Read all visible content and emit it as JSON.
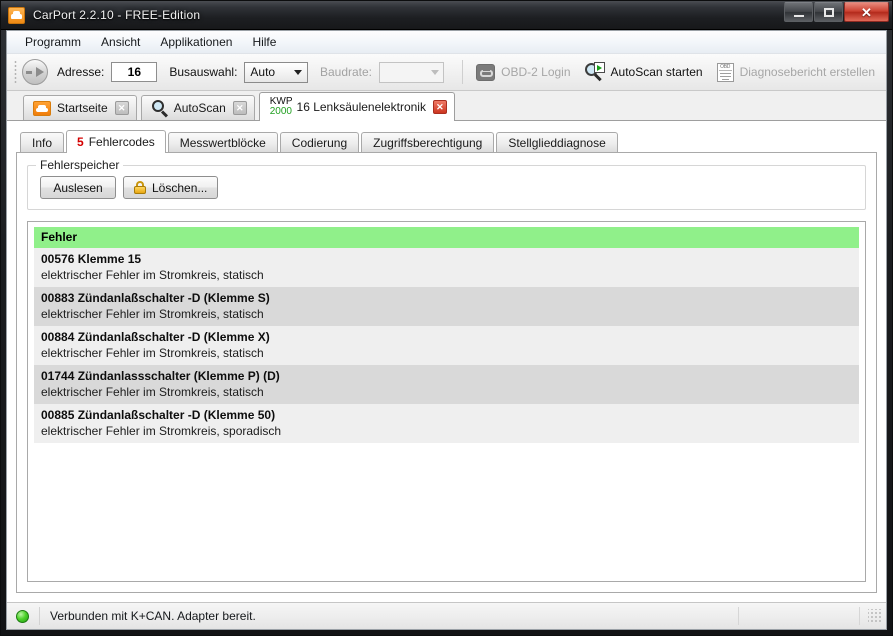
{
  "window": {
    "title": "CarPort 2.2.10  - FREE-Edition",
    "app_icon": "car-icon",
    "buttons": {
      "minimize": "–",
      "maximize": "□",
      "close": "✕"
    }
  },
  "menubar": {
    "items": [
      {
        "label": "Programm"
      },
      {
        "label": "Ansicht"
      },
      {
        "label": "Applikationen"
      },
      {
        "label": "Hilfe"
      }
    ]
  },
  "toolbar": {
    "nav_icon": "arrow-right-circle-icon",
    "address_label": "Adresse:",
    "address_value": "16",
    "bus_label": "Busauswahl:",
    "bus_value": "Auto",
    "baudrate_label": "Baudrate:",
    "baudrate_value": "",
    "actions": [
      {
        "label": "OBD-2 Login",
        "icon": "obd-plug-icon",
        "enabled": false
      },
      {
        "label": "AutoScan starten",
        "icon": "magnifier-play-icon",
        "enabled": true
      },
      {
        "label": "Diagnosebericht erstellen",
        "icon": "obd-document-icon",
        "enabled": false
      }
    ]
  },
  "outer_tabs": [
    {
      "label": "Startseite",
      "icon": "car-icon",
      "active": false,
      "close": "✕"
    },
    {
      "label": "AutoScan",
      "icon": "magnifier-icon",
      "active": false,
      "close": "✕"
    },
    {
      "label": "16 Lenksäulenelektronik",
      "protocol_line1": "KWP",
      "protocol_line2": "2000",
      "active": true,
      "close": "✕"
    }
  ],
  "inner_tabs": [
    {
      "label": "Info",
      "count": "",
      "active": false
    },
    {
      "label": "Fehlercodes",
      "count": "5",
      "active": true
    },
    {
      "label": "Messwertblöcke",
      "count": "",
      "active": false
    },
    {
      "label": "Codierung",
      "count": "",
      "active": false
    },
    {
      "label": "Zugriffsberechtigung",
      "count": "",
      "active": false
    },
    {
      "label": "Stellglieddiagnose",
      "count": "",
      "active": false
    }
  ],
  "groupbox": {
    "title": "Fehlerspeicher",
    "read_button": "Auslesen",
    "clear_button": "Löschen...",
    "clear_icon": "padlock-icon"
  },
  "fault_list": {
    "header": "Fehler",
    "header_color": "#90f08a",
    "rows": [
      {
        "code": "00576 Klemme 15",
        "description": "elektrischer Fehler im Stromkreis, statisch"
      },
      {
        "code": "00883 Zündanlaßschalter -D (Klemme S)",
        "description": "elektrischer Fehler im Stromkreis, statisch"
      },
      {
        "code": "00884 Zündanlaßschalter -D (Klemme X)",
        "description": "elektrischer Fehler im Stromkreis, statisch"
      },
      {
        "code": "01744 Zündanlassschalter (Klemme P) (D)",
        "description": "elektrischer Fehler im Stromkreis, statisch"
      },
      {
        "code": "00885 Zündanlaßschalter -D (Klemme 50)",
        "description": "elektrischer Fehler im Stromkreis, sporadisch"
      }
    ]
  },
  "statusbar": {
    "indicator": "status-ok-green",
    "text": "Verbunden mit K+CAN. Adapter bereit."
  }
}
